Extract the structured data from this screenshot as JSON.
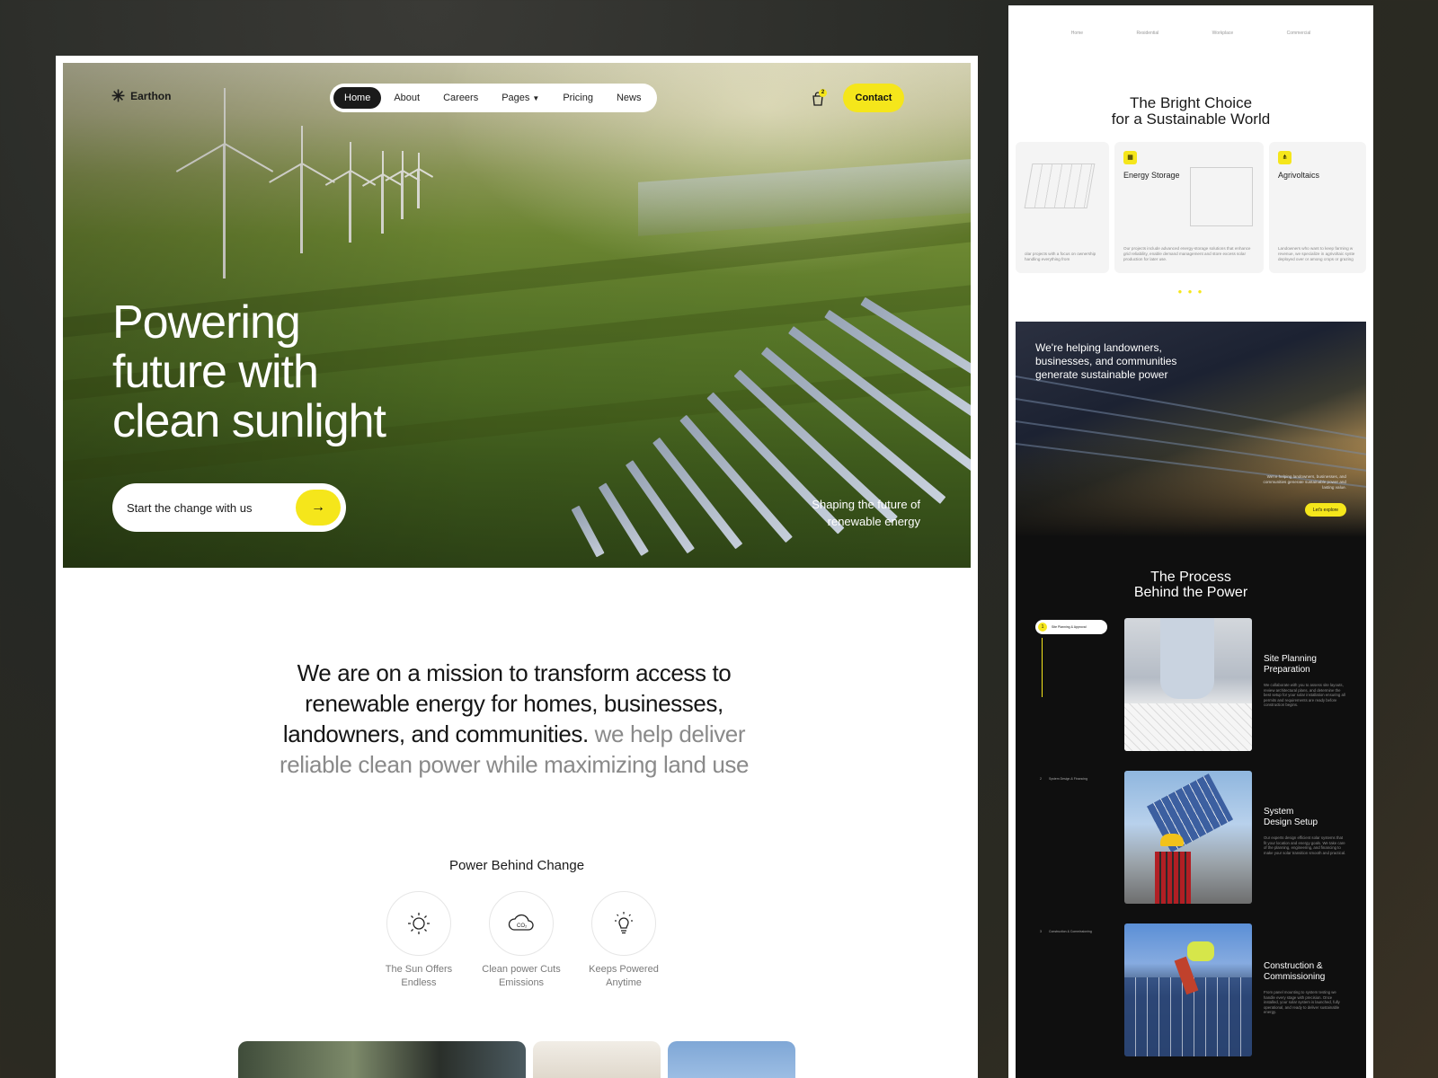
{
  "left": {
    "brand": "Earthon",
    "nav": {
      "items": [
        "Home",
        "About",
        "Careers",
        "Pages",
        "Pricing",
        "News"
      ],
      "active": "Home",
      "cart_count": "2",
      "contact_label": "Contact"
    },
    "hero": {
      "title": "Powering\nfuture with\nclean sunlight",
      "cta_label": "Start the change with us",
      "tagline": "Shaping the future of\nrenewable energy"
    },
    "mission": {
      "dark_text": "We are on a mission to transform access to renewable energy for homes, businesses, landowners, and communities.",
      "muted_text": " we help deliver reliable clean power while maximizing land use"
    },
    "power": {
      "title": "Power Behind Change",
      "features": [
        {
          "label": "The Sun Offers\nEndless",
          "icon": "sun-icon"
        },
        {
          "label": "Clean power Cuts\nEmissions",
          "icon": "co2-cloud-icon"
        },
        {
          "label": "Keeps Powered\nAnytime",
          "icon": "lightbulb-icon"
        }
      ]
    }
  },
  "right": {
    "nav": [
      "Home",
      "Residential",
      "Workplace",
      "Commercial"
    ],
    "heading": "The Bright Choice\nfor a Sustainable World",
    "cards": [
      {
        "title": "",
        "desc": "olar projects with a focus on ownership handling everything from"
      },
      {
        "title": "Energy Storage",
        "desc": "Our projects include advanced energy-storage solutions that enhance grid reliability, enable demand management and store excess solar production for later use."
      },
      {
        "title": "Agrivoltaics",
        "desc": "Landowners who want to keep farming w revenue, we specialize in agrivoltaic syste deployed over or among crops or grazing"
      }
    ],
    "banner": {
      "text": "We're helping landowners,\nbusinesses, and communities\ngenerate sustainable power",
      "small": "We're helping landowners, businesses, and communities generate sustainable power and lasting value.",
      "button": "Let's explore"
    },
    "process": {
      "title": "The Process\nBehind the Power",
      "steps": [
        {
          "num": "1",
          "label": "Site Planning & Approval",
          "title": "Site Planning\nPreparation",
          "desc": "We collaborate with you to assess site layouts, review architectural plans, and determine the best setup for your solar installation ensuring all permits and requirements are ready before construction begins."
        },
        {
          "num": "2",
          "label": "System Design & Financing",
          "title": "System\nDesign Setup",
          "desc": "Our experts design efficient solar systems that fit your location and energy goals. We take care of the planning, engineering, and financing to make your solar transition smooth and practical."
        },
        {
          "num": "3",
          "label": "Construction & Commissioning",
          "title": "Construction &\nCommissioning",
          "desc": "From panel mounting to system testing we handle every stage with precision. Once installed, your solar system is launched, fully operational, and ready to deliver sustainable energy."
        }
      ]
    }
  },
  "colors": {
    "accent": "#f5e61b",
    "dark": "#0f0f0f",
    "text": "#151515",
    "muted": "#8a8a8a"
  }
}
